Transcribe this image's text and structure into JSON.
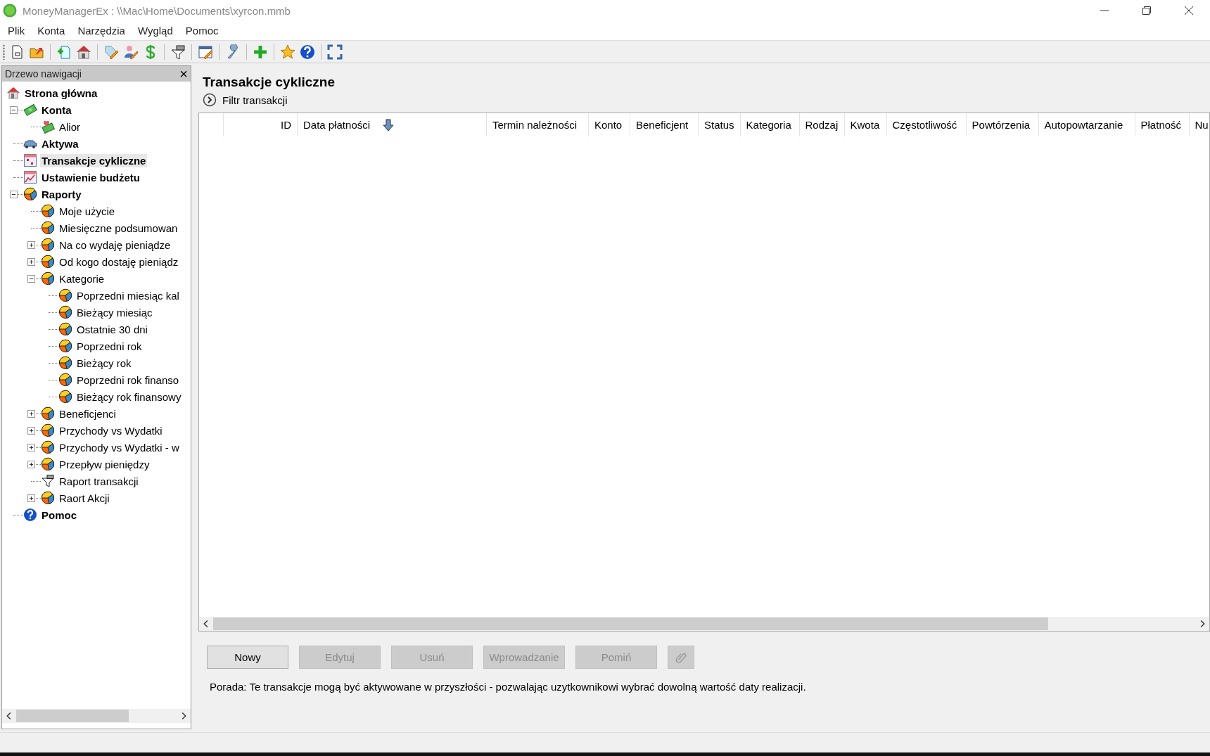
{
  "window": {
    "title": "MoneyManagerEx : \\\\Mac\\Home\\Documents\\xyrcon.mmb"
  },
  "menu": [
    "Plik",
    "Konta",
    "Narzędzia",
    "Wygląd",
    "Pomoc"
  ],
  "sidebar": {
    "title": "Drzewo nawigacji",
    "close": "×",
    "tree": [
      {
        "label": "Strona główna",
        "kind": "home",
        "selected": false,
        "children": [
          {
            "label": "Konta",
            "kind": "money",
            "selected": false,
            "expanded": true,
            "children": [
              {
                "label": "Alior",
                "kind": "money-heart",
                "selected": false
              }
            ]
          },
          {
            "label": "Aktywa",
            "kind": "car",
            "selected": false
          },
          {
            "label": "Transakcje cykliczne",
            "kind": "calendar",
            "selected": true
          },
          {
            "label": "Ustawienie budżetu",
            "kind": "budget",
            "selected": false
          },
          {
            "label": "Raporty",
            "kind": "pie",
            "selected": false,
            "expanded": true,
            "children": [
              {
                "label": "Moje użycie",
                "kind": "pie",
                "selected": false
              },
              {
                "label": "Miesięczne podsumowan",
                "kind": "pie",
                "selected": false
              },
              {
                "label": "Na co wydaję pieniądze",
                "kind": "pie",
                "selected": false,
                "expanded": false
              },
              {
                "label": "Od kogo dostaję pieniądz",
                "kind": "pie",
                "selected": false,
                "expanded": false
              },
              {
                "label": "Kategorie",
                "kind": "pie",
                "selected": false,
                "expanded": true,
                "children": [
                  {
                    "label": "Poprzedni miesiąc kal",
                    "kind": "pie",
                    "selected": false
                  },
                  {
                    "label": "Bieżący miesiąc",
                    "kind": "pie",
                    "selected": false
                  },
                  {
                    "label": "Ostatnie 30 dni",
                    "kind": "pie",
                    "selected": false
                  },
                  {
                    "label": "Poprzedni rok",
                    "kind": "pie",
                    "selected": false
                  },
                  {
                    "label": "Bieżący rok",
                    "kind": "pie",
                    "selected": false
                  },
                  {
                    "label": "Poprzedni rok finanso",
                    "kind": "pie",
                    "selected": false
                  },
                  {
                    "label": "Bieżący rok finansowy",
                    "kind": "pie",
                    "selected": false
                  }
                ]
              },
              {
                "label": "Beneficjenci",
                "kind": "pie",
                "selected": false,
                "expanded": false
              },
              {
                "label": "Przychody vs Wydatki",
                "kind": "pie",
                "selected": false,
                "expanded": false
              },
              {
                "label": "Przychody vs Wydatki - w",
                "kind": "pie",
                "selected": false,
                "expanded": false
              },
              {
                "label": "Przepływ pieniędzy",
                "kind": "pie",
                "selected": false,
                "expanded": false
              },
              {
                "label": "Raport transakcji",
                "kind": "filter",
                "selected": false
              },
              {
                "label": "Raort Akcji",
                "kind": "pie",
                "selected": false,
                "expanded": false
              }
            ]
          },
          {
            "label": "Pomoc",
            "kind": "help",
            "selected": false
          }
        ]
      }
    ]
  },
  "content": {
    "title": "Transakcje cykliczne",
    "filter_label": "Filtr transakcji",
    "table": {
      "columns": [
        {
          "label": "ID",
          "sorted": false
        },
        {
          "label": "Data płatności",
          "sorted": true
        },
        {
          "label": "Termin należności",
          "sorted": false
        },
        {
          "label": "Konto",
          "sorted": false
        },
        {
          "label": "Beneficjent",
          "sorted": false
        },
        {
          "label": "Status",
          "sorted": false
        },
        {
          "label": "Kategoria",
          "sorted": false
        },
        {
          "label": "Rodzaj",
          "sorted": false
        },
        {
          "label": "Kwota",
          "sorted": false
        },
        {
          "label": "Częstotliwość",
          "sorted": false
        },
        {
          "label": "Powtórzenia",
          "sorted": false
        },
        {
          "label": "Autopowtarzanie",
          "sorted": false
        },
        {
          "label": "Płatność",
          "sorted": false
        },
        {
          "label": "Nu",
          "sorted": false
        }
      ]
    },
    "buttons": [
      {
        "kind": "text",
        "label": "Nowy",
        "disabled": false
      },
      {
        "kind": "text",
        "label": "Edytuj",
        "disabled": true
      },
      {
        "kind": "text",
        "label": "Usuń",
        "disabled": true
      },
      {
        "kind": "text",
        "label": "Wprowadzanie",
        "disabled": true
      },
      {
        "kind": "text",
        "label": "Pomiń",
        "disabled": true
      },
      {
        "kind": "attach",
        "disabled": true
      }
    ],
    "tip": "Porada: Te transakcje mogą być aktywowane w przyszłości - pozwalając uzytkownikowi wybrać dowolną wartość daty realizacji."
  }
}
